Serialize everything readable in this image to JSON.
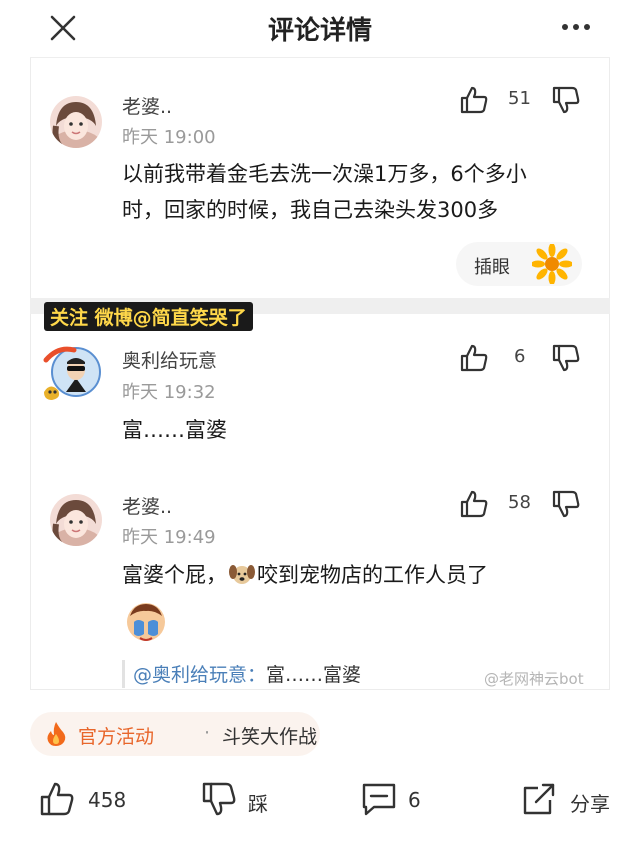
{
  "header": {
    "title": "评论详情",
    "close_icon": "close-icon",
    "more_icon": "more-icon"
  },
  "main_comment": {
    "username": "老婆..",
    "time": "昨天 19:00",
    "text_line1": "以前我带着金毛去洗一次澡1万多，6个多小",
    "text_line2": "时，回家的时候，我自己去染头发300多",
    "likes": "51",
    "reaction_label": "插眼"
  },
  "watermark_top": {
    "prefix": "关注 微博",
    "handle": "@简直笑哭了"
  },
  "replies": [
    {
      "username": "奥利给玩意",
      "time": "昨天 19:32",
      "text": "富……富婆",
      "likes": "6"
    },
    {
      "username": "老婆..",
      "time": "昨天 19:49",
      "text_before": "富婆个屁，",
      "text_after": "咬到宠物店的工作人员了",
      "likes": "58",
      "quote_mention": "@奥利给玩意：",
      "quote_text": "富……富婆"
    }
  ],
  "watermark_bottom": "@老网神云bot",
  "activity": {
    "tag": "官方活动",
    "separator": "·",
    "name": "斗笑大作战"
  },
  "bottom_bar": {
    "likes": "458",
    "dislike_label": "踩",
    "comments": "6",
    "share_label": "分享"
  },
  "colors": {
    "accent_orange": "#e8662b",
    "link_blue": "#4a7fb8",
    "muted_gray": "#9a9a9a"
  }
}
